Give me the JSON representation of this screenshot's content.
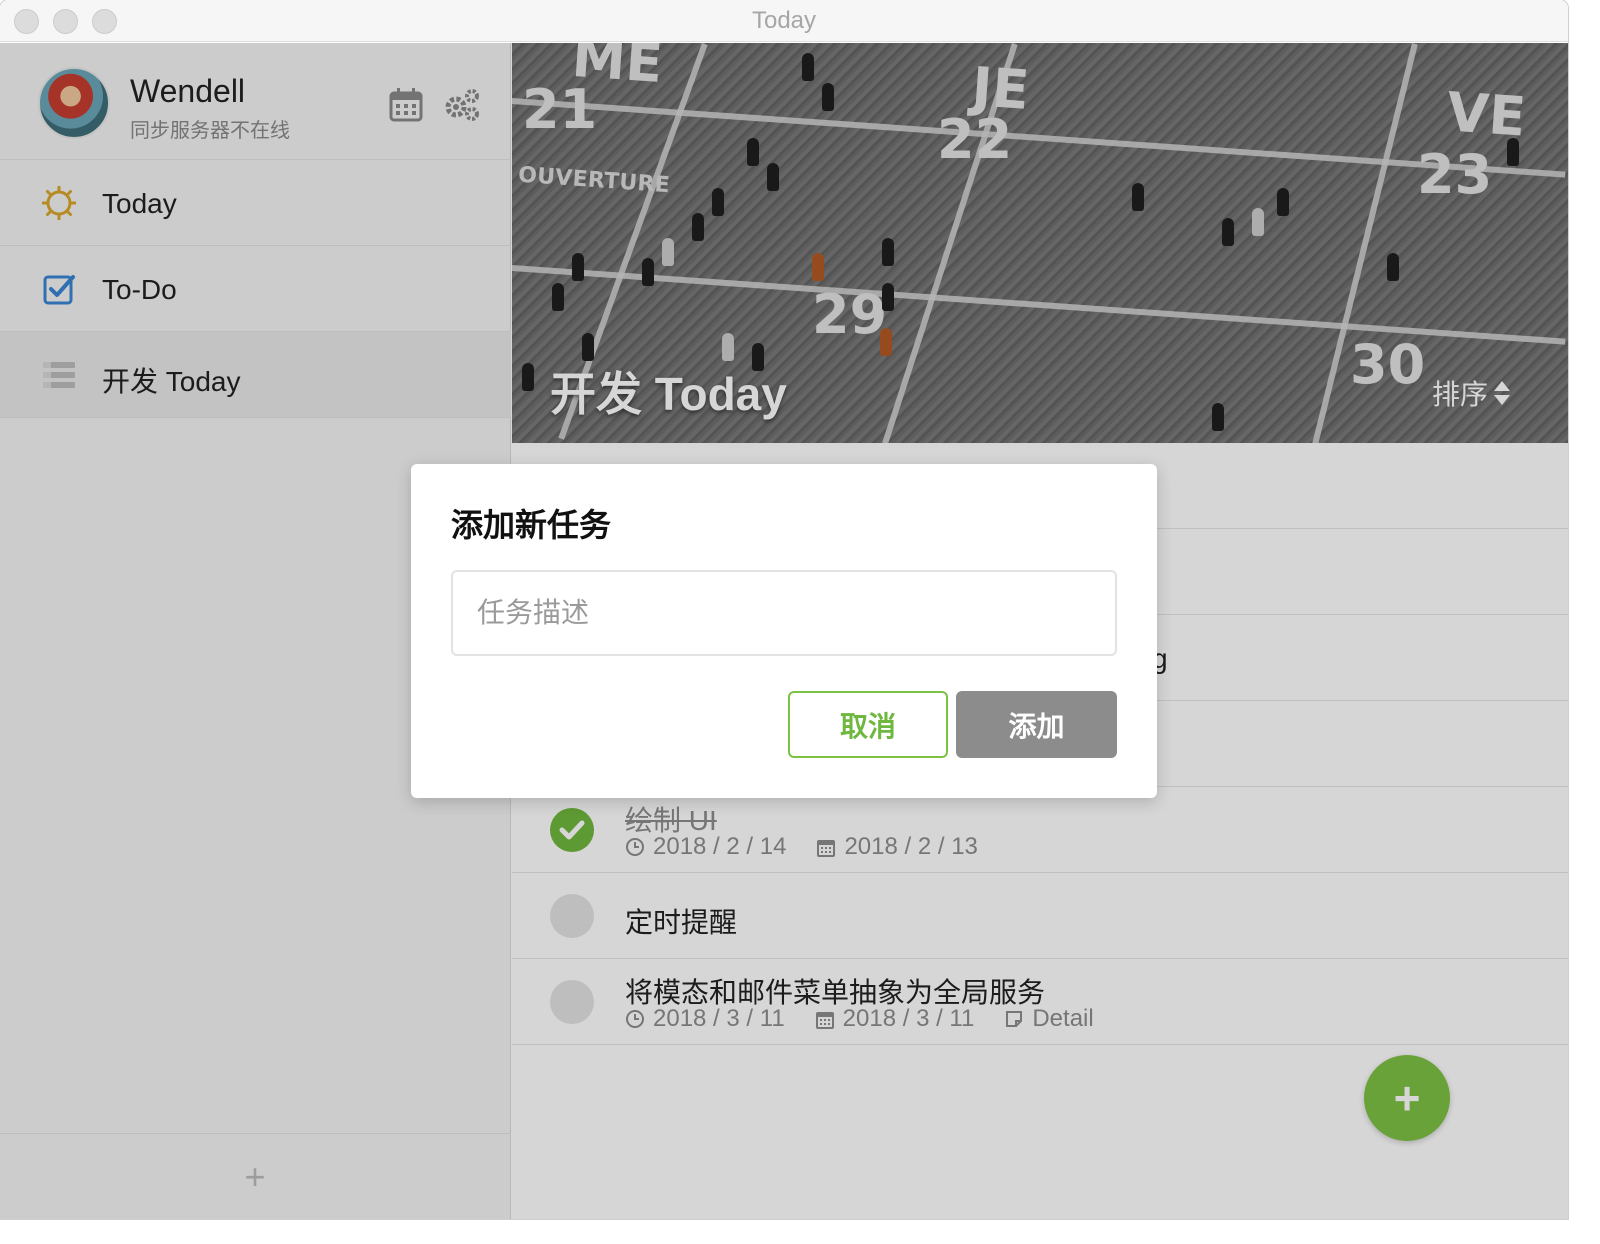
{
  "window": {
    "title": "Today"
  },
  "profile": {
    "name": "Wendell",
    "status": "同步服务器不在线"
  },
  "sidebar": {
    "items": [
      {
        "label": "Today",
        "icon": "sun-icon",
        "color": "#d9a62b"
      },
      {
        "label": "To-Do",
        "icon": "checkbox-icon",
        "color": "#3a86d4"
      },
      {
        "label": "开发 Today",
        "icon": "list-icon"
      }
    ],
    "add_label": "+"
  },
  "banner": {
    "title": "开发 Today",
    "sort_label": "排序",
    "image_text": {
      "words": [
        "ME",
        "JE",
        "VE",
        "OUVERTURE"
      ],
      "days": [
        "21",
        "22",
        "23",
        "29",
        "30"
      ]
    }
  },
  "tasks": [
    {
      "title": "绘制 UI",
      "done": true,
      "reminder": "2018 / 2 / 14",
      "due": "2018 / 2 / 13"
    },
    {
      "title": "定时提醒",
      "done": false
    },
    {
      "title": "将模态和邮件菜单抽象为全局服务",
      "done": false,
      "reminder": "2018 / 3 / 11",
      "due": "2018 / 3 / 11",
      "detail": "Detail"
    }
  ],
  "partial_text": {
    "row3_tail": "g"
  },
  "fab_label": "+",
  "modal": {
    "title": "添加新任务",
    "input_placeholder": "任务描述",
    "input_value": "",
    "cancel_label": "取消",
    "add_label": "添加"
  },
  "colors": {
    "accent": "#7cc243",
    "add_button_disabled": "#8c8c8c"
  }
}
